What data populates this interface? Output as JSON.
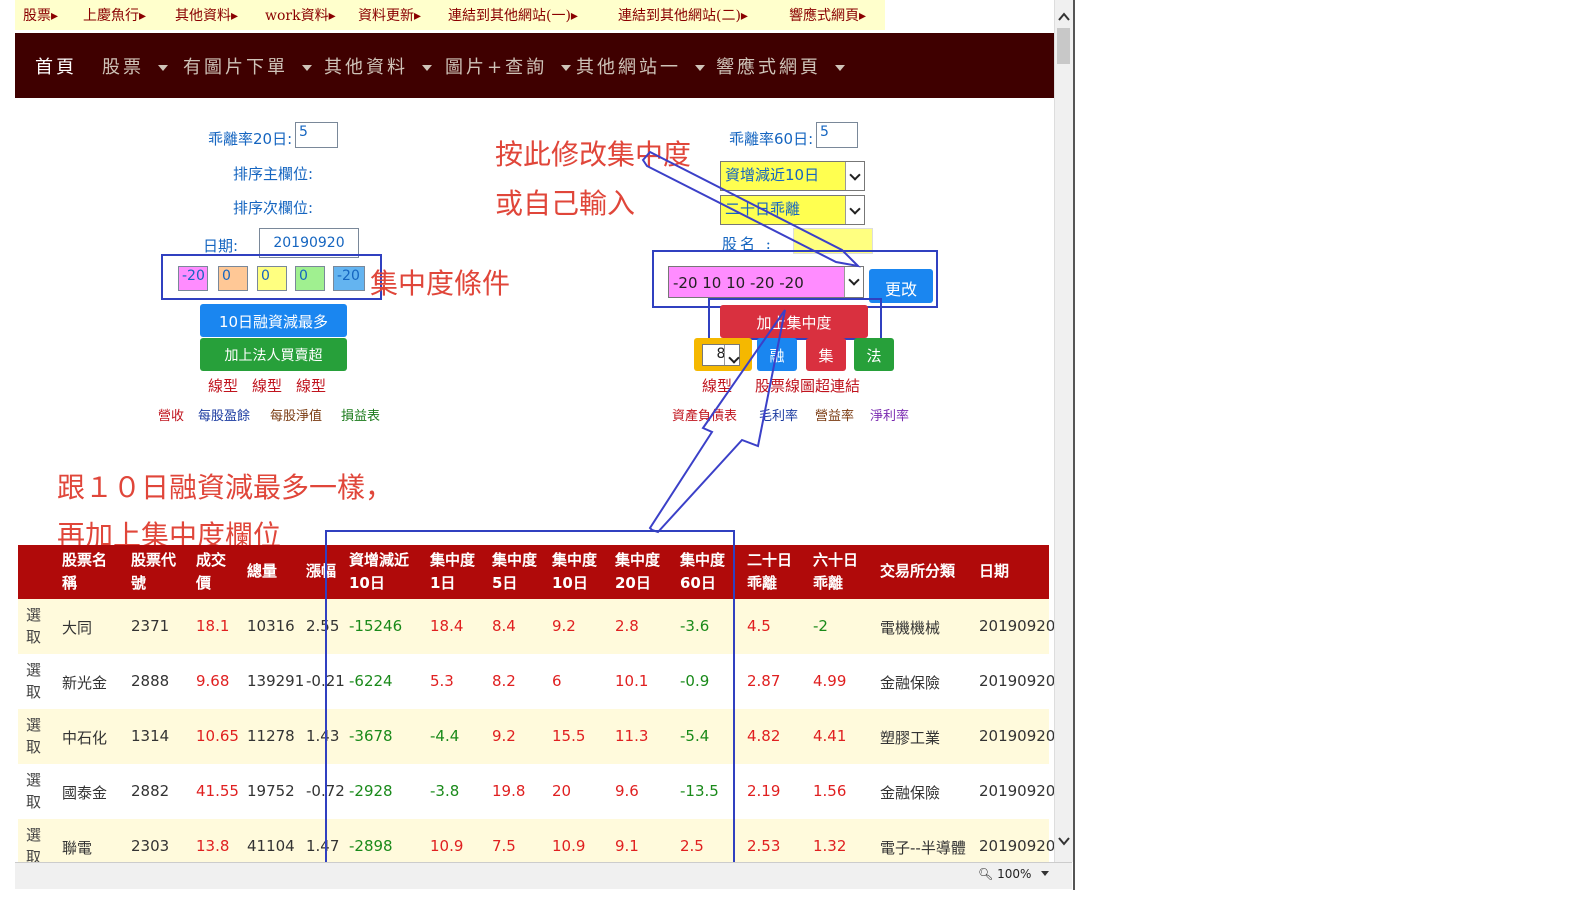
{
  "toplinks": [
    "股票▸",
    "上慶魚行▸",
    "其他資料▸",
    "work資料▸",
    "資料更新▸",
    "連結到其他網站(一)▸",
    "連結到其他網站(二)▸",
    "響應式網頁▸"
  ],
  "nav": {
    "home": "首頁",
    "items": [
      "股票",
      "有圖片下單",
      "其他資料",
      "圖片+查詢",
      "其他網站一",
      "響應式網頁"
    ]
  },
  "left_form": {
    "bias20_label": "乖離率20日:",
    "bias20_value": "5",
    "sort_main_label": "排序主欄位:",
    "sort_sub_label": "排序次欄位:",
    "date_label": "日期:",
    "date_value": "20190920",
    "conc_inputs": [
      "-20",
      "0",
      "0",
      "0",
      "-20"
    ],
    "btn_margin": "10日融資減最多",
    "btn_inst": "加上法人買賣超",
    "links_line": [
      "線型",
      "線型",
      "線型"
    ],
    "links_fin": [
      "營收",
      "每股盈餘",
      "每股淨值",
      "損益表"
    ]
  },
  "right_form": {
    "bias60_label": "乖離率60日:",
    "bias60_value": "5",
    "select1": "資增減近10日",
    "select2": "二十日乖離",
    "stock_name_label": "股名 :",
    "conc_select": "-20 10 10 -20 -20",
    "btn_change": "更改",
    "btn_add_conc": "加上集中度",
    "small_select": "8",
    "btn_margin_small": "融",
    "btn_conc_small": "集",
    "btn_law_small": "法",
    "links_line": [
      "線型",
      "股票線圖超連結"
    ],
    "links_fin": [
      "資產負債表",
      "毛利率",
      "營益率",
      "淨利率"
    ]
  },
  "annotations": {
    "modify_line1": "按此修改集中度",
    "modify_line2": "或自己輸入",
    "conc_cond": "集中度條件",
    "same_line1": "跟１０日融資減最多一樣，",
    "same_line2": "再加上集中度欄位"
  },
  "table": {
    "headers": [
      [
        "股票名",
        "稱"
      ],
      [
        "股票代",
        "號"
      ],
      [
        "成交",
        "價"
      ],
      [
        "總量"
      ],
      [
        "漲幅"
      ],
      [
        "資增減近",
        "10日"
      ],
      [
        "集中度",
        "1日"
      ],
      [
        "集中度",
        "5日"
      ],
      [
        "集中度",
        "10日"
      ],
      [
        "集中度",
        "20日"
      ],
      [
        "集中度",
        "60日"
      ],
      [
        "二十日",
        "乖離"
      ],
      [
        "六十日",
        "乖離"
      ],
      [
        "交易所分類"
      ],
      [
        "日期"
      ]
    ],
    "select_label": "選取",
    "rows": [
      [
        "大同",
        "2371",
        "18.1",
        "10316",
        "2.55",
        "-15246",
        "18.4",
        "8.4",
        "9.2",
        "2.8",
        "-3.6",
        "4.5",
        "-2",
        "電機機械",
        "20190920"
      ],
      [
        "新光金",
        "2888",
        "9.68",
        "139291",
        "-0.21",
        "-6224",
        "5.3",
        "8.2",
        "6",
        "10.1",
        "-0.9",
        "2.87",
        "4.99",
        "金融保險",
        "20190920"
      ],
      [
        "中石化",
        "1314",
        "10.65",
        "11278",
        "1.43",
        "-3678",
        "-4.4",
        "9.2",
        "15.5",
        "11.3",
        "-5.4",
        "4.82",
        "4.41",
        "塑膠工業",
        "20190920"
      ],
      [
        "國泰金",
        "2882",
        "41.55",
        "19752",
        "-0.72",
        "-2928",
        "-3.8",
        "19.8",
        "20",
        "9.6",
        "-13.5",
        "2.19",
        "1.56",
        "金融保險",
        "20190920"
      ],
      [
        "聯電",
        "2303",
        "13.8",
        "41104",
        "1.47",
        "-2898",
        "10.9",
        "7.5",
        "10.9",
        "9.1",
        "2.5",
        "2.53",
        "1.32",
        "電子--半導體",
        "20190920"
      ]
    ]
  },
  "status": {
    "zoom": "100%"
  }
}
